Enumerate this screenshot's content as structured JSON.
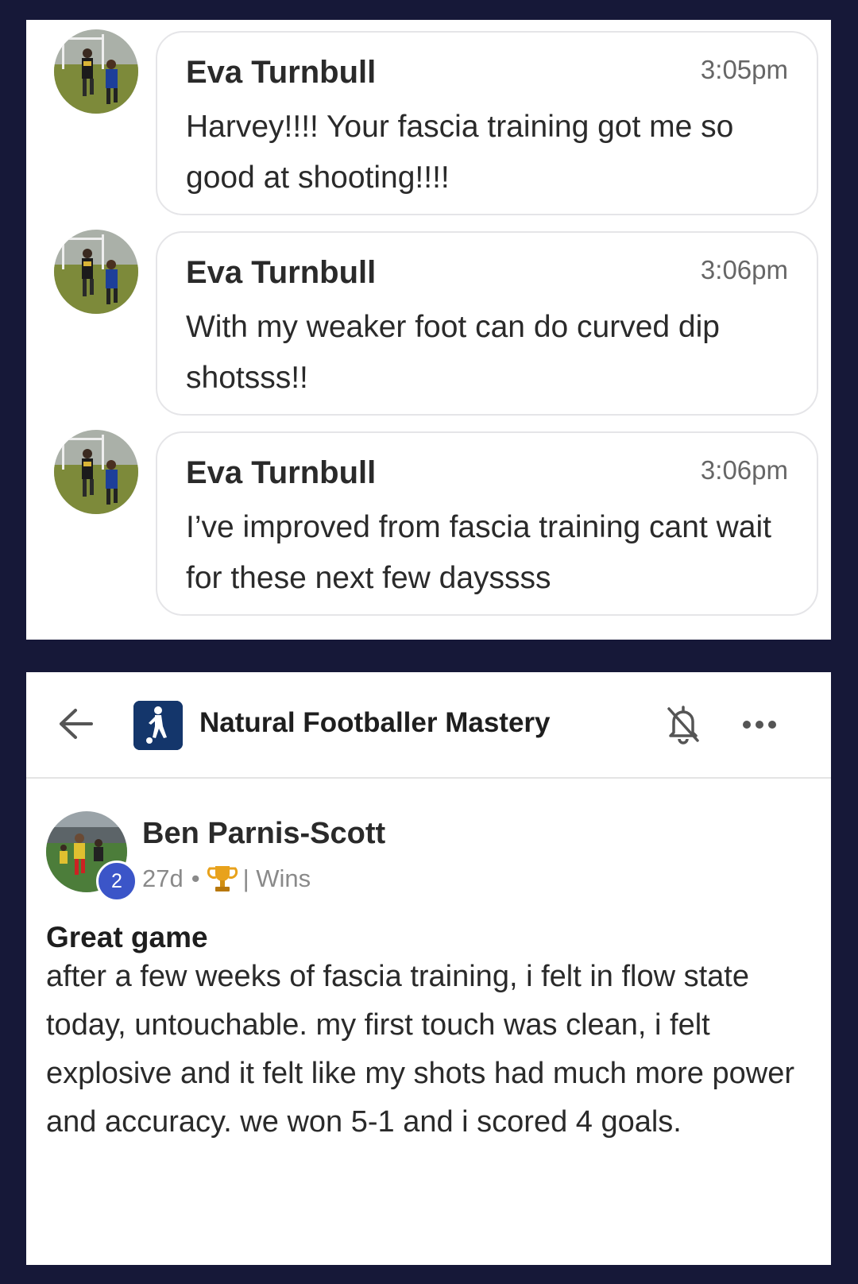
{
  "chat": {
    "messages": [
      {
        "author": "Eva Turnbull",
        "time": "3:05pm",
        "text": "Harvey!!!! Your fascia training got me so good at shooting!!!!"
      },
      {
        "author": "Eva Turnbull",
        "time": "3:06pm",
        "text": "With my weaker foot can do curved dip shotsss!!"
      },
      {
        "author": "Eva Turnbull",
        "time": "3:06pm",
        "text": "I’ve improved from fascia training cant wait for these next few dayssss"
      }
    ]
  },
  "group": {
    "title": "Natural Footballer Mastery",
    "icons": {
      "back": "arrow-left-icon",
      "notifications": "bell-off-icon",
      "more": "more-horizontal-icon",
      "logo": "footballer-logo-icon"
    }
  },
  "post": {
    "author": "Ben Parnis-Scott",
    "level": "2",
    "age": "27d",
    "separator": "•",
    "category": "| Wins",
    "category_icon": "trophy-icon",
    "title": "Great game",
    "body": "after a few weeks of fascia training, i felt in flow state today, untouchable. my first touch was clean, i felt explosive and it felt like my shots had much more power and accuracy. we won 5-1 and i scored 4 goals."
  },
  "colors": {
    "frame": "#161838",
    "level_badge": "#3b55c8",
    "logo_bg": "#14366b",
    "bubble_border": "#e5e5e8"
  }
}
